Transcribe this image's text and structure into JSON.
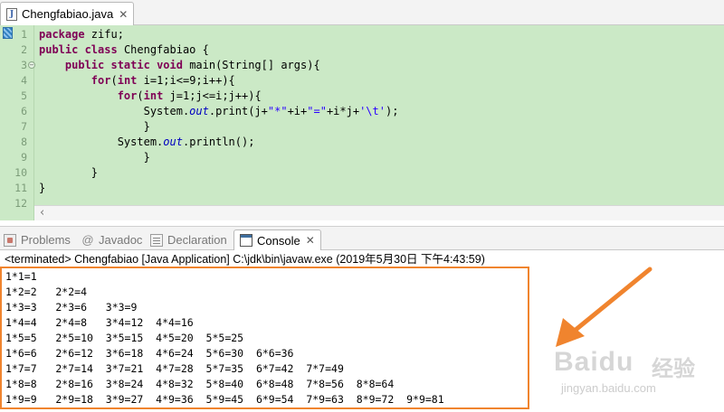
{
  "editor": {
    "tab": {
      "title": "Chengfabiao.java",
      "icon": "java-file-icon"
    },
    "code_lines": [
      [
        {
          "t": "package ",
          "c": "kw"
        },
        {
          "t": "zifu;"
        }
      ],
      [
        {
          "t": "public ",
          "c": "kw"
        },
        {
          "t": "class ",
          "c": "kw"
        },
        {
          "t": "Chengfabiao {"
        }
      ],
      [
        {
          "t": "    "
        },
        {
          "t": "public ",
          "c": "kw"
        },
        {
          "t": "static ",
          "c": "kw"
        },
        {
          "t": "void ",
          "c": "kw"
        },
        {
          "t": "main(String[] args){"
        }
      ],
      [
        {
          "t": "        "
        },
        {
          "t": "for",
          "c": "kw"
        },
        {
          "t": "("
        },
        {
          "t": "int ",
          "c": "kw"
        },
        {
          "t": "i=1;i<=9;i++){"
        }
      ],
      [
        {
          "t": "            "
        },
        {
          "t": "for",
          "c": "kw"
        },
        {
          "t": "("
        },
        {
          "t": "int ",
          "c": "kw"
        },
        {
          "t": "j=1;j<=i;j++){"
        }
      ],
      [
        {
          "t": "                System."
        },
        {
          "t": "out",
          "c": "fld"
        },
        {
          "t": ".print(j+"
        },
        {
          "t": "\"*\"",
          "c": "str"
        },
        {
          "t": "+i+"
        },
        {
          "t": "\"=\"",
          "c": "str"
        },
        {
          "t": "+i*j+"
        },
        {
          "t": "'\\t'",
          "c": "str"
        },
        {
          "t": ");"
        }
      ],
      [
        {
          "t": "                }"
        }
      ],
      [
        {
          "t": "            System."
        },
        {
          "t": "out",
          "c": "fld"
        },
        {
          "t": ".println();"
        }
      ],
      [
        {
          "t": "                }"
        }
      ],
      [
        {
          "t": "        }"
        }
      ],
      [
        {
          "t": "}"
        }
      ],
      []
    ],
    "line_numbers": [
      "1",
      "2",
      "3",
      "4",
      "5",
      "6",
      "7",
      "8",
      "9",
      "10",
      "11",
      "12"
    ],
    "colors": {
      "background": "#cbe9c6",
      "keyword": "#7f0055",
      "string": "#2a00ff",
      "field": "#0000c0"
    }
  },
  "views": {
    "tabs": [
      {
        "label": "Problems",
        "icon": "problems-icon"
      },
      {
        "label": "Javadoc",
        "icon": "at-icon",
        "glyph": "@"
      },
      {
        "label": "Declaration",
        "icon": "declaration-icon"
      },
      {
        "label": "Console",
        "icon": "console-icon",
        "active": true
      }
    ]
  },
  "console": {
    "status": "<terminated> Chengfabiao [Java Application] C:\\jdk\\bin\\javaw.exe (2019年5月30日 下午4:43:59)",
    "output_lines": [
      "1*1=1",
      "1*2=2   2*2=4",
      "1*3=3   2*3=6   3*3=9",
      "1*4=4   2*4=8   3*4=12  4*4=16",
      "1*5=5   2*5=10  3*5=15  4*5=20  5*5=25",
      "1*6=6   2*6=12  3*6=18  4*6=24  5*6=30  6*6=36",
      "1*7=7   2*7=14  3*7=21  4*7=28  5*7=35  6*7=42  7*7=49",
      "1*8=8   2*8=16  3*8=24  4*8=32  5*8=40  6*8=48  7*8=56  8*8=64",
      "1*9=9   2*9=18  3*9=27  4*9=36  5*9=45  6*9=54  7*9=63  8*9=72  9*9=81"
    ],
    "highlight_color": "#f0842e"
  },
  "watermark": {
    "brand": "Baidu",
    "brand_cn": "经验",
    "url": "jingyan.baidu.com"
  },
  "icons": {
    "close": "close-icon",
    "fold": "fold-collapse-icon",
    "scroll_left": "chevron-left-icon",
    "arrow": "arrow-annotation-icon"
  }
}
